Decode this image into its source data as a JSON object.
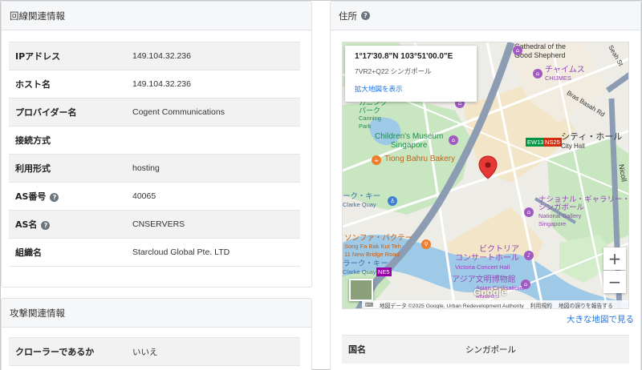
{
  "line_info": {
    "title": "回線関連情報",
    "rows": [
      {
        "label": "IPアドレス",
        "value": "149.104.32.236",
        "help": false
      },
      {
        "label": "ホスト名",
        "value": "149.104.32.236",
        "help": false
      },
      {
        "label": "プロバイダー名",
        "value": "Cogent Communications",
        "help": false
      },
      {
        "label": "接続方式",
        "value": "",
        "help": false
      },
      {
        "label": "利用形式",
        "value": "hosting",
        "help": false
      },
      {
        "label": "AS番号",
        "value": "40065",
        "help": true
      },
      {
        "label": "AS名",
        "value": "CNSERVERS",
        "help": true
      },
      {
        "label": "組織名",
        "value": "Starcloud Global Pte. LTD",
        "help": false
      }
    ]
  },
  "attack_info": {
    "title": "攻撃関連情報",
    "rows": [
      {
        "label": "クローラーであるか",
        "value": "いいえ"
      }
    ]
  },
  "address": {
    "title": "住所",
    "help_icon": "?",
    "larger_map_link": "大きな地図で見る",
    "country_label": "国名",
    "country_value": "シンガポール"
  },
  "map": {
    "infobox": {
      "coordinates": "1°17'30.8\"N 103°51'00.0\"E",
      "plus_code": "7VR2+Q22 シンガポール",
      "enlarge_link": "拡大地図を表示"
    },
    "labels": {
      "cathedral_1": "Cathedral of the",
      "cathedral_2": "Good Shepherd",
      "seah_st": "Seah St",
      "chijmes_jp": "チャイムス",
      "chijmes": "CHIJMES",
      "bras_basah": "Bras Basah Rd",
      "fort_canning_1": "カニング",
      "fort_canning_2": "パーク",
      "fort_canning_3": "Canning",
      "fort_canning_4": "Park",
      "childrens_museum_1": "Children's Museum",
      "childrens_museum_2": "Singapore",
      "city_hall_jp": "シティ・ホール",
      "city_hall": "City Hall",
      "ew13": "EW13",
      "ns25": "NS25",
      "tiong_bahru": "Tiong Bahru Bakery",
      "nicoll": "Nicoll",
      "clarke_quay_jp": "ーク・キー",
      "clarke_quay": "Clarke Quay",
      "national_gallery_jp_1": "ナショナル・ギャラリー・",
      "national_gallery_jp_2": "シンガポール",
      "national_gallery_1": "National Gallery",
      "national_gallery_2": "Singapore",
      "song_fa_jp": "ソンファ・バクテー",
      "song_fa_1": "Song Fa Bak Kut Teh",
      "song_fa_2": "11 New Bridge Road",
      "victoria_jp_1": "ビクトリア",
      "victoria_jp_2": "コンサートホール",
      "victoria": "Victoria Concert Hall",
      "clarke_quay2_jp": "ラーク・キー",
      "clarke_quay2": "Clarke Quay",
      "ne5": "NE5",
      "acm_jp": "アジア文明博物館",
      "acm_1": "Asian Civilisations",
      "acm_2": "Museum",
      "google": "Google"
    },
    "attribution": {
      "data": "地図データ ©2025 Google, Urban Redevelopment Authority",
      "terms": "利用規約",
      "report": "地図の誤りを報告する"
    },
    "zoom_in": "+",
    "zoom_out": "−",
    "colors": {
      "water": "#9ecae8",
      "park": "#c8e6c0",
      "road": "#ffffff",
      "highway": "#8c9db3",
      "marker": "#e53935"
    }
  }
}
